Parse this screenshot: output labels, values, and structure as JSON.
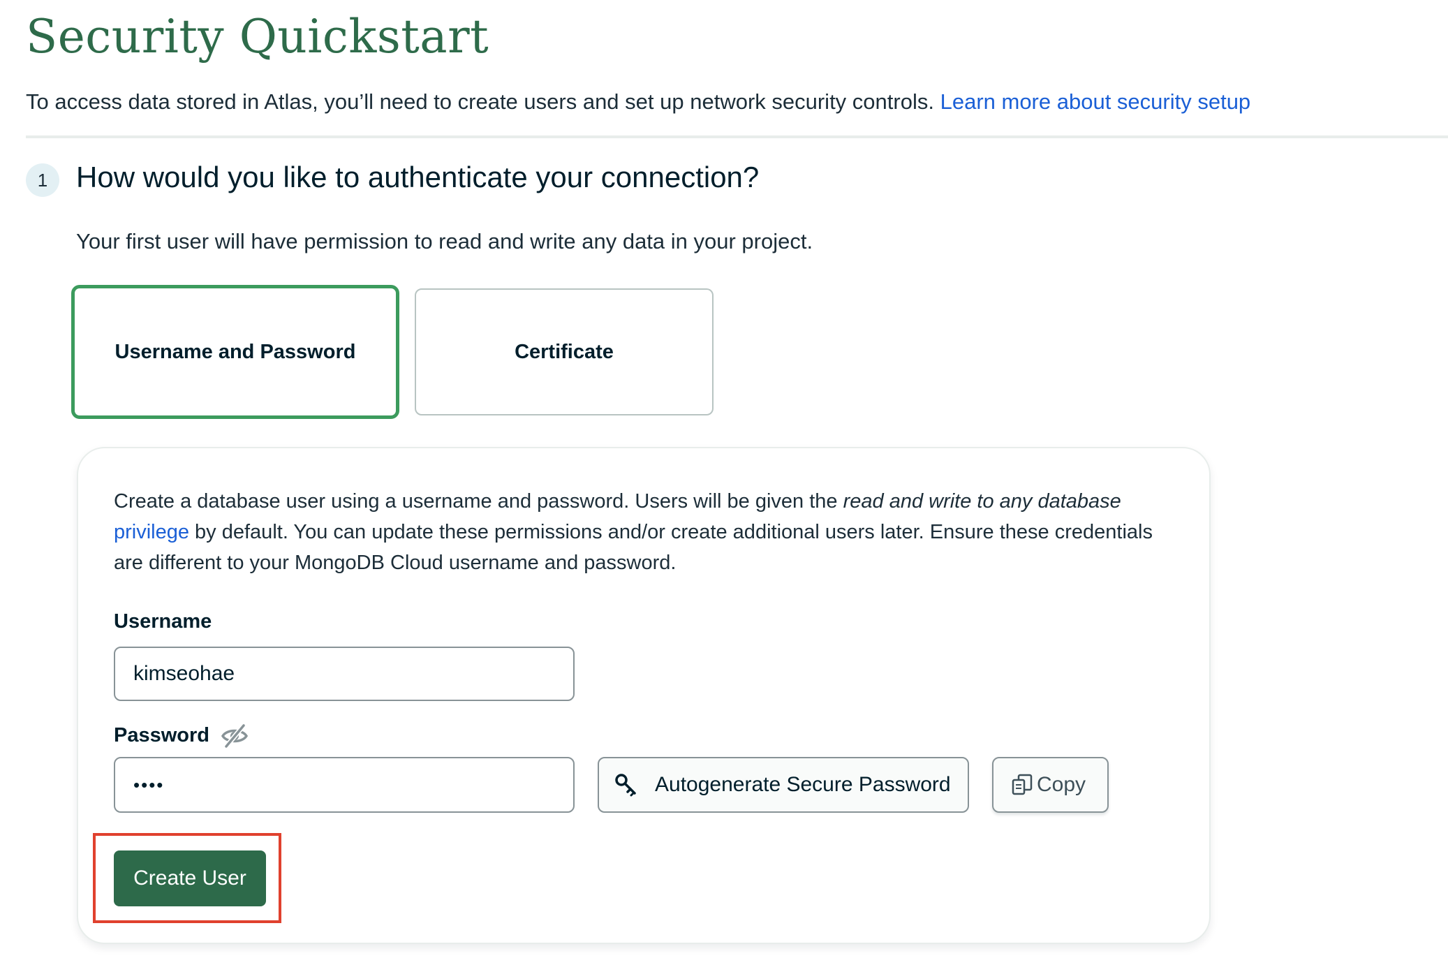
{
  "header": {
    "title": "Security Quickstart",
    "intro_text": "To access data stored in Atlas, you’ll need to create users and set up network security controls.",
    "intro_link": "Learn more about security setup"
  },
  "step": {
    "number": "1",
    "title": "How would you like to authenticate your connection?",
    "subtitle": "Your first user will have permission to read and write any data in your project."
  },
  "auth_options": [
    {
      "label": "Username and Password",
      "selected": true
    },
    {
      "label": "Certificate",
      "selected": false
    }
  ],
  "card": {
    "desc_part1": "Create a database user using a username and password. Users will be given the ",
    "desc_emphasis": "read and write to any database",
    "desc_link": "privilege",
    "desc_part2": " by default. You can update these permissions and/or create additional users later. Ensure these credentials are different to your MongoDB Cloud username and password.",
    "username_label": "Username",
    "username_value": "kimseohae",
    "password_label": "Password",
    "password_value": "••••",
    "autogenerate_label": "Autogenerate Secure Password",
    "copy_label": "Copy",
    "create_label": "Create User"
  },
  "icons": {
    "password_visibility": "eye-slash-icon",
    "autogenerate": "key-icon",
    "copy": "copy-icon"
  },
  "colors": {
    "title_green": "#2e6b4a",
    "selected_border": "#3c9b5d",
    "primary_button": "#2d6a4a",
    "link_blue": "#1a5fd6",
    "highlight_red": "#e0412e"
  }
}
